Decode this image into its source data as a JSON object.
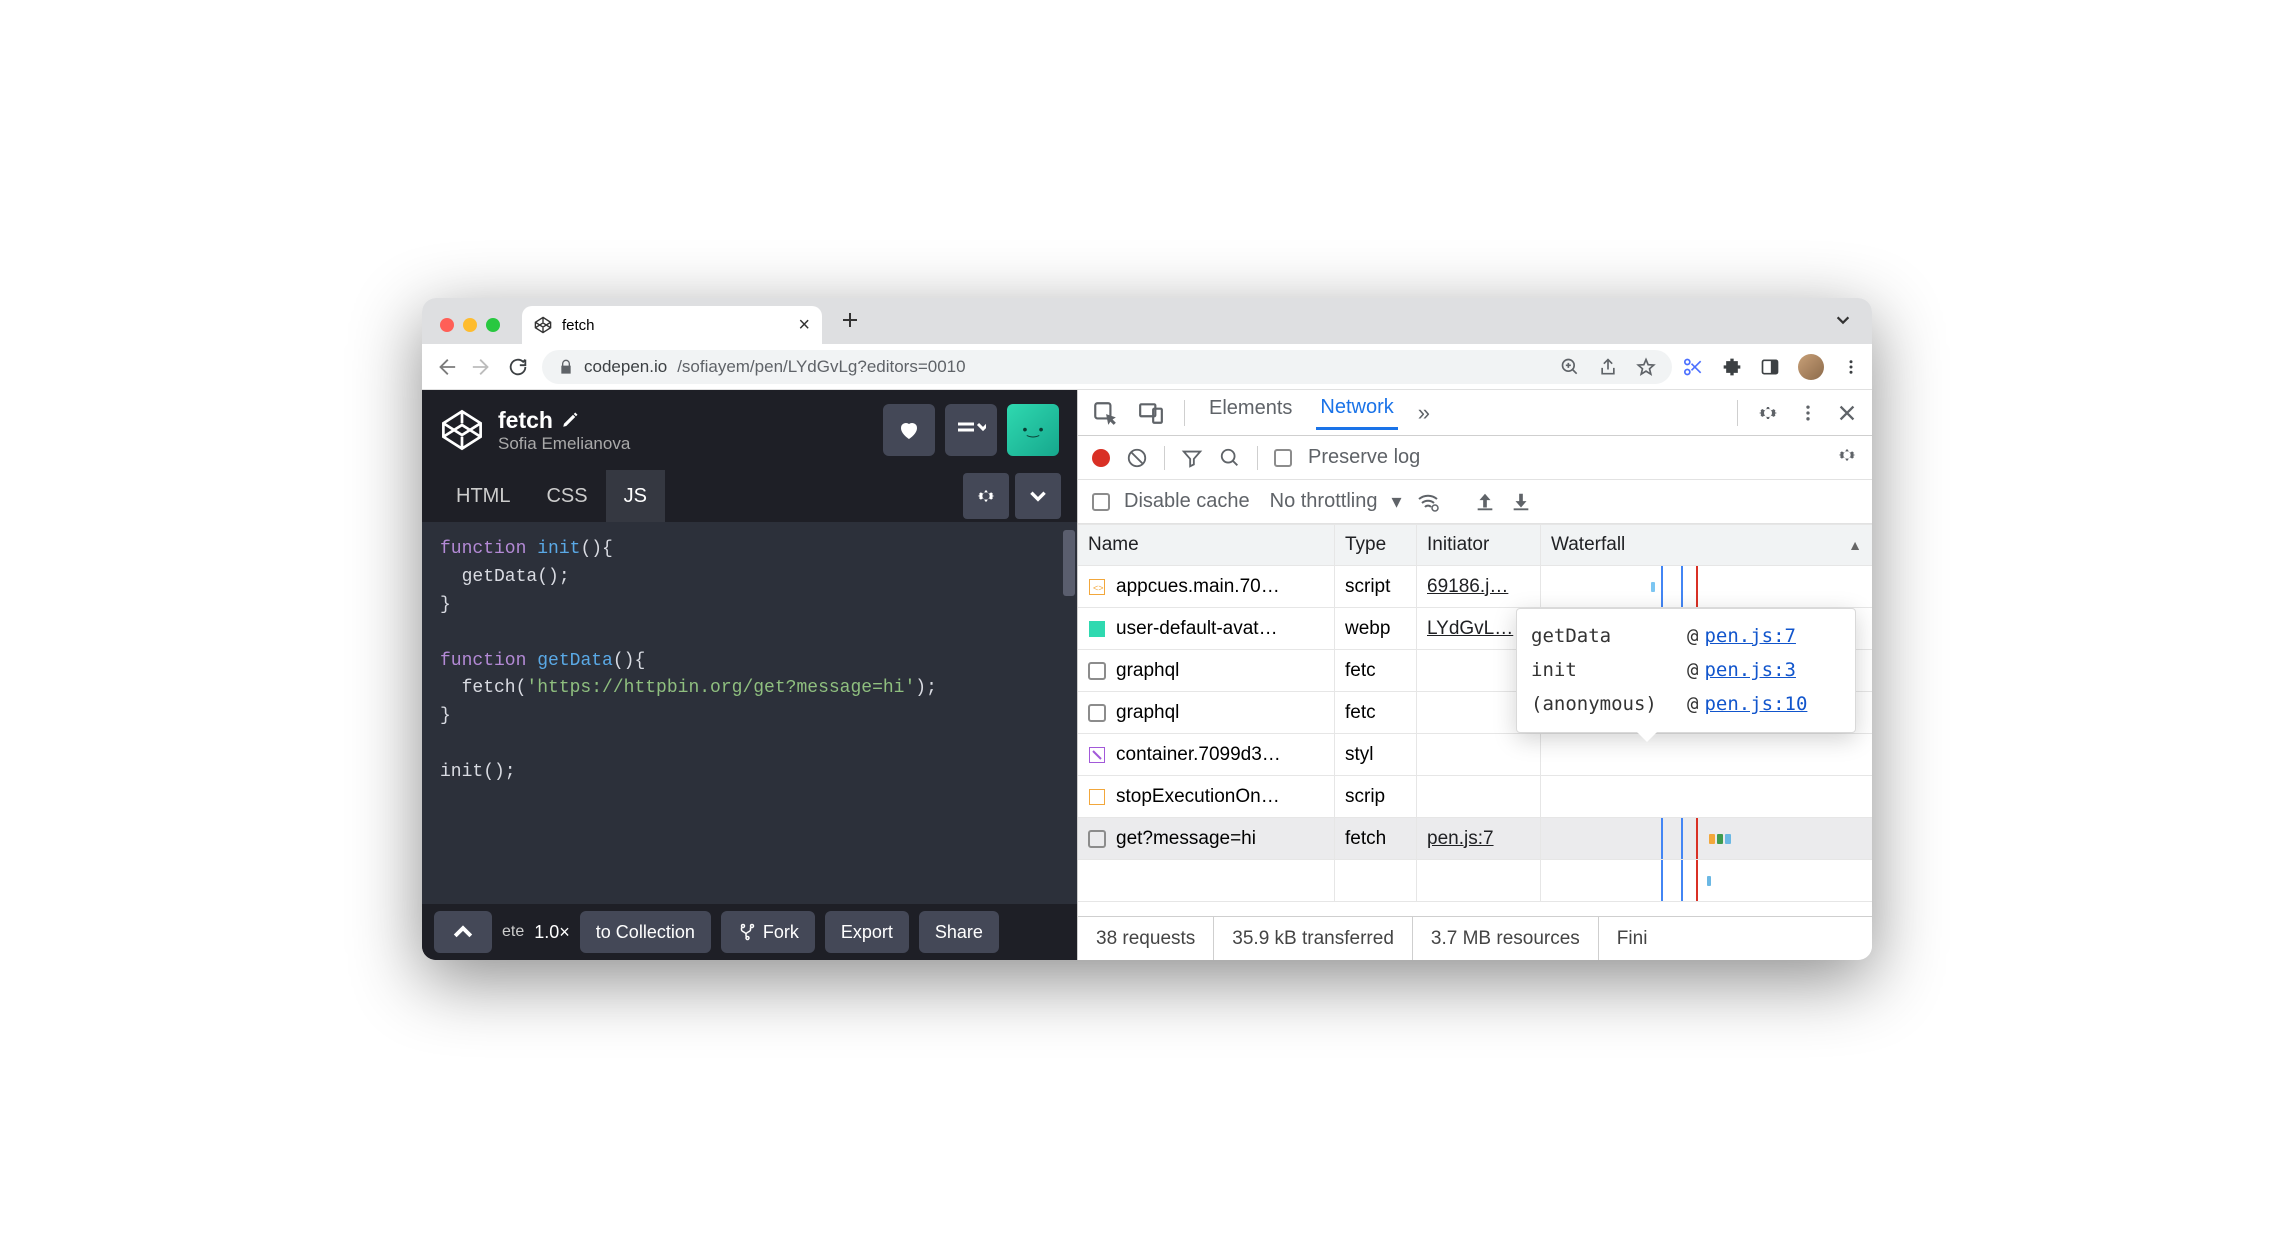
{
  "browser": {
    "tab_title": "fetch",
    "url_host": "codepen.io",
    "url_path": "/sofiayem/pen/LYdGvLg?editors=0010"
  },
  "codepen": {
    "title": "fetch",
    "author": "Sofia Emelianova",
    "tabs": {
      "html": "HTML",
      "css": "CSS",
      "js": "JS"
    },
    "active_tab": "JS",
    "footer": {
      "zoom": "1.0×",
      "to_collection": "to Collection",
      "fork": "Fork",
      "export": "Export",
      "share": "Share",
      "ete_fragment": "ete"
    },
    "code": {
      "l1_kw": "function",
      "l1_fn": "init",
      "l1_rest": "(){",
      "l2": "  getData();",
      "l3": "}",
      "l4_kw": "function",
      "l4_fn": "getData",
      "l4_rest": "(){",
      "l5_pre": "  fetch(",
      "l5_str": "'https://httpbin.org/get?message=hi'",
      "l5_post": ");",
      "l6": "}",
      "l7": "init();"
    }
  },
  "devtools": {
    "tabs": {
      "elements": "Elements",
      "network": "Network"
    },
    "preserve_log": "Preserve log",
    "disable_cache": "Disable cache",
    "throttling": "No throttling",
    "columns": {
      "name": "Name",
      "type": "Type",
      "initiator": "Initiator",
      "waterfall": "Waterfall"
    },
    "rows": [
      {
        "name": "appcues.main.70…",
        "type": "script",
        "initiator": "69186.j…",
        "icon": "js"
      },
      {
        "name": "user-default-avat…",
        "type": "webp",
        "initiator": "LYdGvL…",
        "icon": "img"
      },
      {
        "name": "graphql",
        "type": "fetc",
        "initiator": "",
        "icon": "doc"
      },
      {
        "name": "graphql",
        "type": "fetc",
        "initiator": "",
        "icon": "doc"
      },
      {
        "name": "container.7099d3…",
        "type": "styl",
        "initiator": "",
        "icon": "css"
      },
      {
        "name": "stopExecutionOn…",
        "type": "scrip",
        "initiator": "",
        "icon": "js"
      },
      {
        "name": "get?message=hi",
        "type": "fetch",
        "initiator": "pen.js:7",
        "icon": "doc",
        "highlight": true
      }
    ],
    "tooltip": [
      {
        "fn": "getData",
        "loc": "pen.js:7"
      },
      {
        "fn": "init",
        "loc": "pen.js:3"
      },
      {
        "fn": "(anonymous)",
        "loc": "pen.js:10"
      }
    ],
    "status": {
      "requests": "38 requests",
      "transferred": "35.9 kB transferred",
      "resources": "3.7 MB resources",
      "finish": "Fini"
    }
  }
}
